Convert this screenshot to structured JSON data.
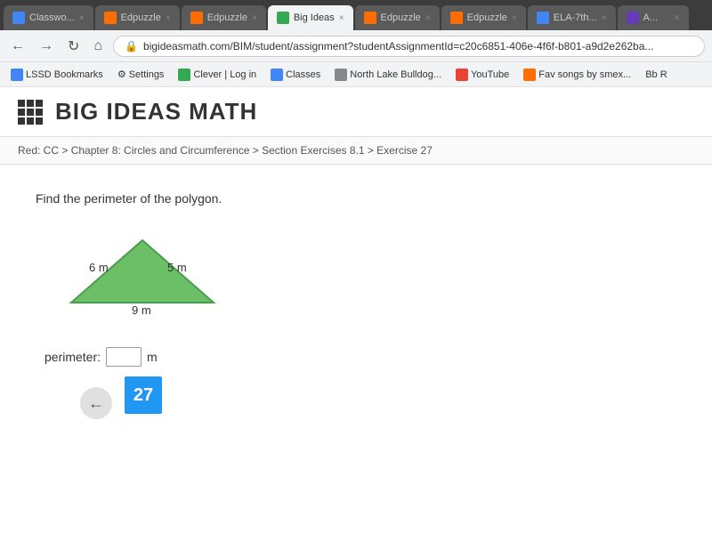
{
  "browser": {
    "tabs": [
      {
        "id": "classwo",
        "label": "Classwo...",
        "favicon_color": "#4285f4",
        "active": false
      },
      {
        "id": "edpuzzle1",
        "label": "Edpuzzle",
        "favicon_color": "#ff6d00",
        "active": false
      },
      {
        "id": "edpuzzle2",
        "label": "Edpuzzle",
        "favicon_color": "#ff6d00",
        "active": false
      },
      {
        "id": "bigideas",
        "label": "Big Ideas",
        "favicon_color": "#34a853",
        "active": true
      },
      {
        "id": "edpuzzle3",
        "label": "Edpuzzle",
        "favicon_color": "#ff6d00",
        "active": false
      },
      {
        "id": "edpuzzle4",
        "label": "Edpuzzle",
        "favicon_color": "#ff6d00",
        "active": false
      },
      {
        "id": "ela7th",
        "label": "ELA-7th...",
        "favicon_color": "#4285f4",
        "active": false
      },
      {
        "id": "tab-a",
        "label": "A...",
        "favicon_color": "#673ab7",
        "active": false
      }
    ],
    "url": "bigideasmath.com/BIM/student/assignment?studentAssignmentId=c20c6851-406e-4f6f-b801-a9d2e262ba...",
    "bookmarks": [
      {
        "label": "LSSD Bookmarks",
        "icon_color": "#4285f4"
      },
      {
        "label": "Settings",
        "icon_color": "#888"
      },
      {
        "label": "Clever | Log in",
        "icon_color": "#34a853"
      },
      {
        "label": "Classes",
        "icon_color": "#4285f4"
      },
      {
        "label": "North Lake Bulldog...",
        "icon_color": "#888"
      },
      {
        "label": "YouTube",
        "icon_color": "#ea4335"
      },
      {
        "label": "Fav songs by smex...",
        "icon_color": "#ff6d00"
      },
      {
        "label": "Bb R",
        "icon_color": "#555"
      }
    ]
  },
  "page": {
    "site_title": "BIG IDEAS MATH",
    "breadcrumb": "Red: CC > Chapter 8: Circles and Circumference > Section Exercises 8.1 > Exercise 27",
    "exercise": {
      "question": "Find the perimeter of the polygon.",
      "triangle": {
        "side_left_label": "6 m",
        "side_right_label": "5 m",
        "side_bottom_label": "9 m"
      },
      "answer_label": "perimeter:",
      "answer_unit": "m",
      "exercise_number": "27"
    }
  }
}
